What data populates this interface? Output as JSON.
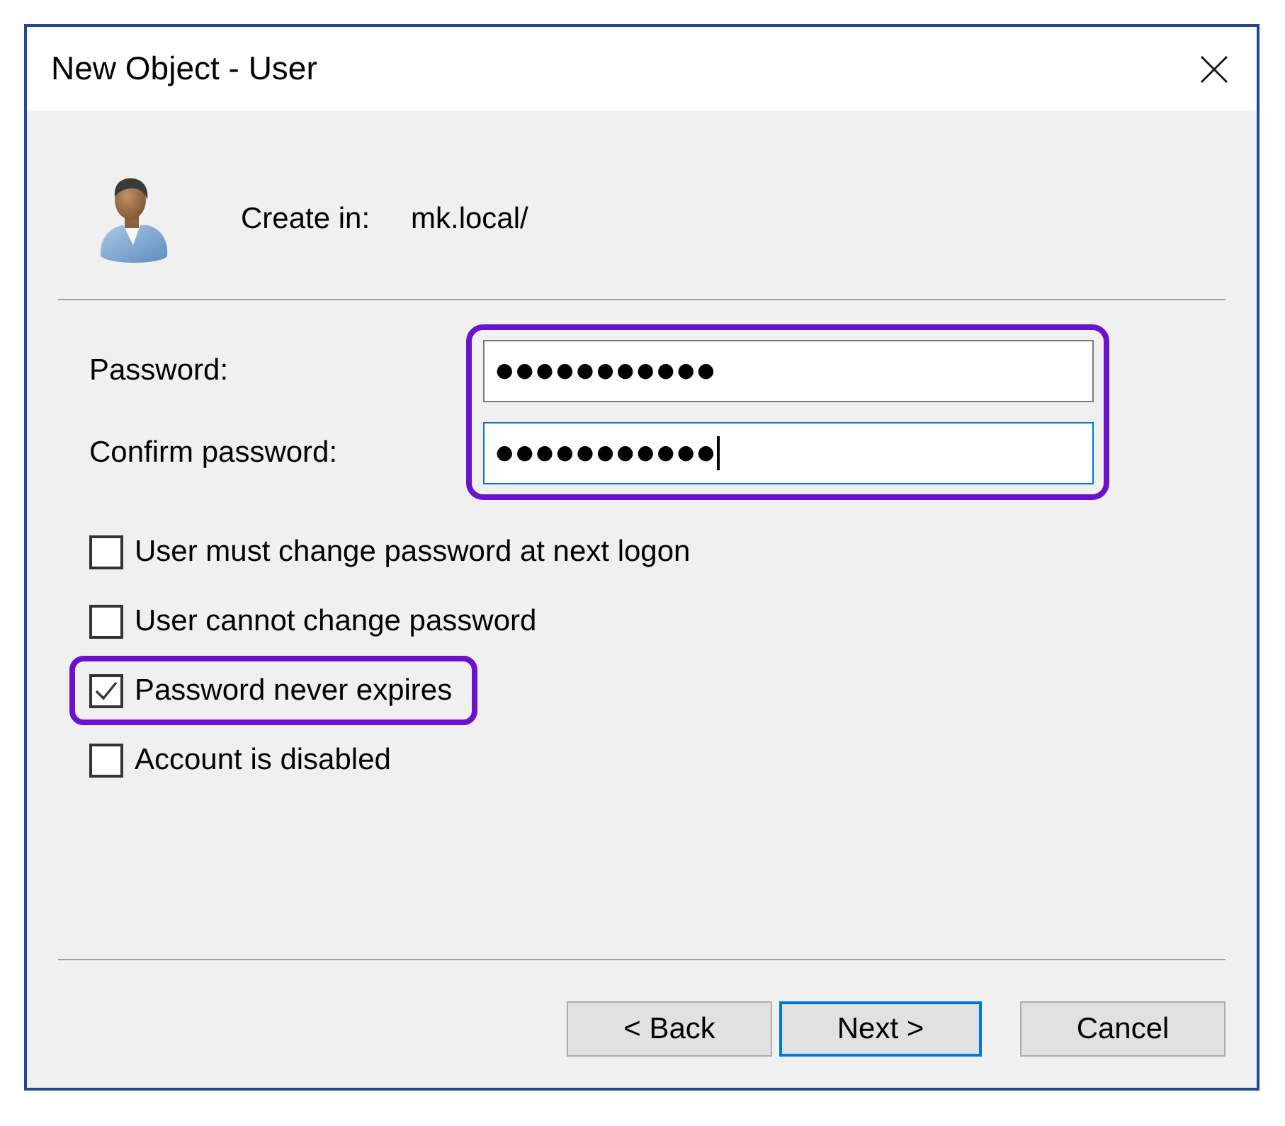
{
  "window": {
    "title": "New Object - User"
  },
  "create_in": {
    "label": "Create in:",
    "value": "mk.local/"
  },
  "password_fields": {
    "highlighted": true,
    "fields": [
      {
        "label": "Password:",
        "value": "●●●●●●●●●●●",
        "focused": false
      },
      {
        "label": "Confirm password:",
        "value": "●●●●●●●●●●●",
        "focused": true
      }
    ]
  },
  "options": [
    {
      "label": "User must change password at next logon",
      "checked": false,
      "highlighted": false
    },
    {
      "label": "User cannot change password",
      "checked": false,
      "highlighted": false
    },
    {
      "label": "Password never expires",
      "checked": true,
      "highlighted": true
    },
    {
      "label": "Account is disabled",
      "checked": false,
      "highlighted": false
    }
  ],
  "buttons": [
    {
      "label": "< Back",
      "default": false
    },
    {
      "label": "Next >",
      "default": true
    },
    {
      "label": "Cancel",
      "default": false
    }
  ]
}
